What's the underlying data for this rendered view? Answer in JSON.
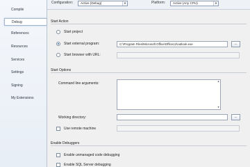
{
  "sidebar": {
    "items": [
      {
        "label": "Compile"
      },
      {
        "label": "Debug"
      },
      {
        "label": "References"
      },
      {
        "label": "Resources"
      },
      {
        "label": "Services"
      },
      {
        "label": "Settings"
      },
      {
        "label": "Signing"
      },
      {
        "label": "My Extensions"
      }
    ]
  },
  "toolbar": {
    "configuration_label": "Configuration:",
    "configuration_value": "Active (Debug)",
    "platform_label": "Platform:",
    "platform_value": "Active (Any CPU)"
  },
  "start_action": {
    "title": "Start Action",
    "start_project": "Start project",
    "start_external_program": "Start external program:",
    "external_program_path": "C:\\Program Files\\Microsoft Office\\Office12\\outlook.exe",
    "start_browser": "Start browser with URL:",
    "browse_label": "..."
  },
  "start_options": {
    "title": "Start Options",
    "command_line_label": "Command line arguments:",
    "working_directory_label": "Working directory:",
    "use_remote_label": "Use remote machine"
  },
  "enable_debuggers": {
    "title": "Enable Debuggers",
    "unmanaged": "Enable unmanaged code debugging",
    "sql_server": "Enable SQL Server debugging"
  }
}
